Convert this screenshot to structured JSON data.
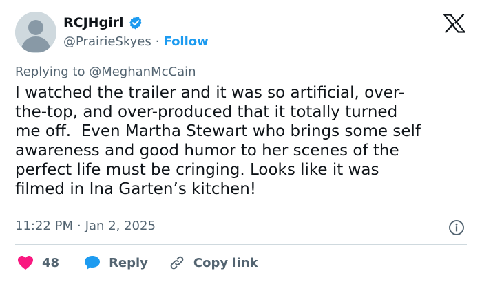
{
  "author": {
    "display_name": "RCJHgirl",
    "handle": "@PrairieSkyes",
    "separator": "·",
    "follow_label": "Follow"
  },
  "reply_to": "Replying to @MeghanMcCain",
  "tweet": {
    "lines": [
      "I watched the trailer and it was so artificial, over-",
      "the-top, and over-produced that it totally turned",
      "me off.  Even Martha Stewart who brings some self",
      "awareness and good humor to her scenes of the",
      "perfect life must be cringing. Looks like it was",
      "filmed in Ina Garten’s kitchen!"
    ]
  },
  "meta": {
    "time": "11:22 PM",
    "separator": "·",
    "date": "Jan 2, 2025"
  },
  "actions": {
    "likes": "48",
    "reply_label": "Reply",
    "copy_label": "Copy link"
  },
  "icons": {
    "verified": "verified-badge-icon",
    "logo": "x-logo-icon",
    "info": "info-icon",
    "like": "heart-icon",
    "reply": "speech-bubble-icon",
    "link": "link-icon"
  },
  "colors": {
    "text": "#0f1419",
    "secondary": "#536471",
    "accent": "#1d9bf0",
    "like": "#f91880",
    "divider": "#cfd9de"
  }
}
